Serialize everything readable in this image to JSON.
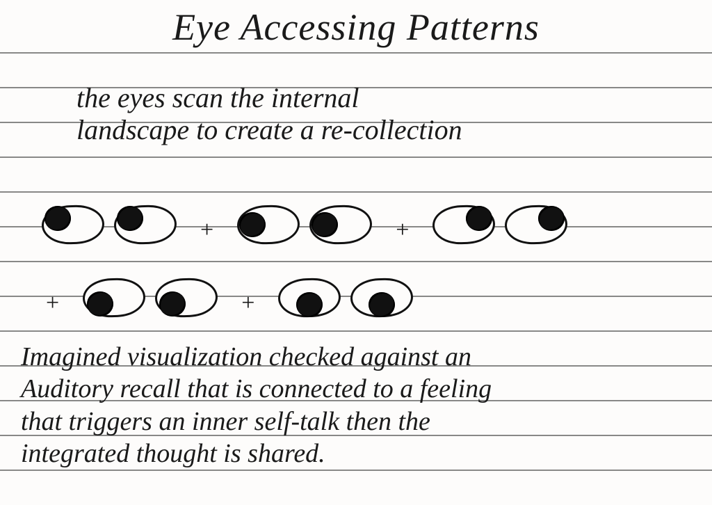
{
  "title": "Eye Accessing Patterns",
  "subtitle_line1": "the eyes scan the internal",
  "subtitle_line2": "landscape to create a re-collection",
  "plus": "+",
  "eye_sequence": {
    "pair1_gaze": "up-left",
    "pair2_gaze": "left",
    "pair3_gaze": "up-right",
    "pair4_gaze": "down-left",
    "pair5_gaze": "down-center"
  },
  "explanation_line1": "Imagined visualization checked against an",
  "explanation_line2": "Auditory recall that is connected to a feeling",
  "explanation_line3": "that triggers an inner self-talk then the",
  "explanation_line4": "integrated thought is shared."
}
